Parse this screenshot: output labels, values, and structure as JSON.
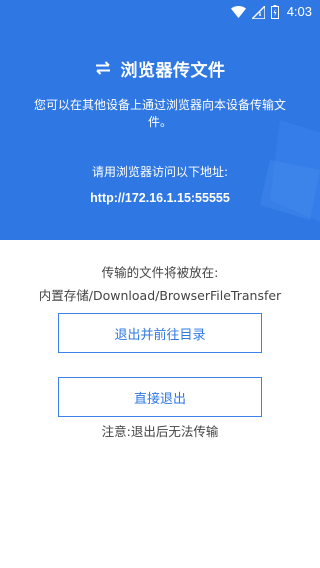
{
  "status_bar": {
    "time": "4:03",
    "icons": [
      "wifi-icon",
      "signal-icon",
      "battery-icon"
    ]
  },
  "header": {
    "icon": "swap-arrows-icon",
    "title": "浏览器传文件",
    "description": "您可以在其他设备上通过浏览器向本设备传输文件。",
    "prompt": "请用浏览器访问以下地址:",
    "address": "http://172.16.1.15:55555"
  },
  "main": {
    "save_label": "传输的文件将被放在:",
    "save_path": "内置存储/Download/BrowserFileTransfer",
    "exit_open_button": "退出并前往目录",
    "exit_button": "直接退出",
    "note": "注意:退出后无法传输"
  },
  "colors": {
    "header_bg": "#2f78e4",
    "button_text": "#2f78e4",
    "button_border": "#3a82ea",
    "body_text": "#444444"
  }
}
